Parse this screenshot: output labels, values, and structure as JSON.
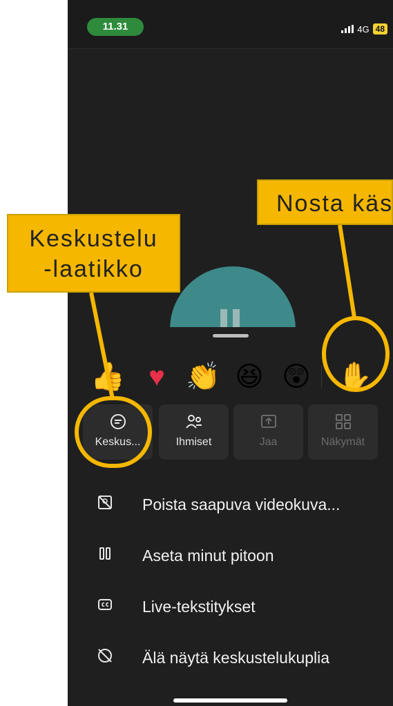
{
  "status": {
    "time": "11.31",
    "network": "4G",
    "battery": "48"
  },
  "reactions": {
    "thumb": "👍",
    "heart": "♥",
    "clap": "👏",
    "laugh": "😆",
    "wow": "😲",
    "raise_hand": "✋"
  },
  "actions": [
    {
      "label": "Keskus...",
      "icon": "chat-icon"
    },
    {
      "label": "Ihmiset",
      "icon": "people-icon"
    },
    {
      "label": "Jaa",
      "icon": "share-icon"
    },
    {
      "label": "Näkymät",
      "icon": "views-icon"
    }
  ],
  "menu": [
    {
      "label": "Poista saapuva videokuva...",
      "icon": "video-off-icon"
    },
    {
      "label": "Aseta minut pitoon",
      "icon": "pause-icon"
    },
    {
      "label": "Live-tekstitykset",
      "icon": "captions-icon"
    },
    {
      "label": "Älä näytä keskustelukuplia",
      "icon": "chat-bubble-off-icon"
    }
  ],
  "annotations": {
    "chat_box_line1": "Keskustelu",
    "chat_box_line2": "-laatikko",
    "raise_hand": "Nosta käsi"
  },
  "colors": {
    "callout": "#f5b700",
    "avatar": "#3e8a8a",
    "background": "#1f1f1f"
  }
}
